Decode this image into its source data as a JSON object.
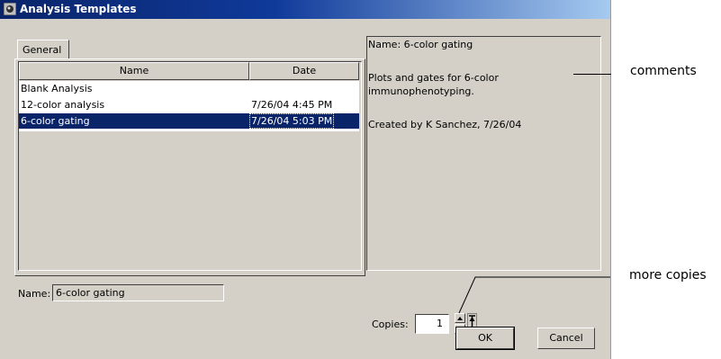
{
  "window": {
    "title": "Analysis Templates"
  },
  "tabs": [
    {
      "label": "General"
    }
  ],
  "table": {
    "columns": [
      "Name",
      "Date"
    ],
    "rows": [
      {
        "name": "Blank Analysis",
        "date": ""
      },
      {
        "name": "12-color analysis",
        "date": "7/26/04 4:45 PM"
      },
      {
        "name": "6-color gating",
        "date": "7/26/04 5:03 PM",
        "selected": true
      }
    ]
  },
  "comments": {
    "lines": [
      "Name: 6-color gating",
      "Plots and gates for 6-color",
      "immunophenotyping.",
      "Created by K Sanchez, 7/26/04"
    ]
  },
  "name_field": {
    "label": "Name:",
    "value": "6-color gating"
  },
  "copies": {
    "label": "Copies:",
    "value": "1"
  },
  "buttons": {
    "ok": "OK",
    "cancel": "Cancel"
  },
  "annotations": {
    "comments": "comments",
    "more_copies": "more copies"
  },
  "colors": {
    "title_start": "#0a246a",
    "title_end": "#a6caf0",
    "selection": "#0a246a",
    "dialog_bg": "#d4d0c8"
  },
  "icons": [
    "app-icon",
    "spin-up-icon",
    "spin-down-icon",
    "max-copies-icon"
  ]
}
